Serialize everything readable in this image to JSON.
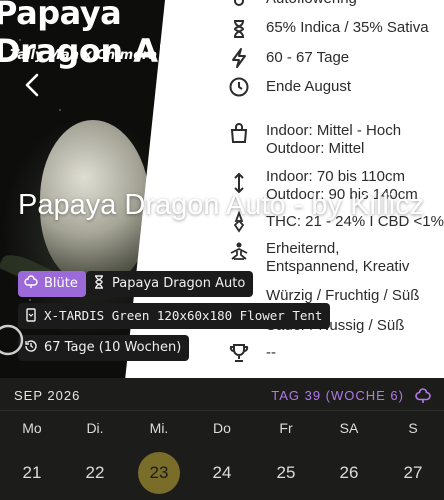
{
  "hero": {
    "strain_logo_line1": "Papaya",
    "strain_logo_line2": "Dragon Auto",
    "strain_cross": "Tally Man x Chimera",
    "overlay_title": "Papaya Dragon Auto - by Killicz"
  },
  "specs": [
    {
      "icon": "flower-icon",
      "text": "Autoflowering"
    },
    {
      "icon": "hourglass-icon",
      "text": "65% Indica / 35% Sativa"
    },
    {
      "icon": "lightning-icon",
      "text": "60 - 67 Tage"
    },
    {
      "icon": "clock-icon",
      "text": "Ende August"
    },
    {
      "icon": "bag-icon",
      "text": "Indoor: Mittel - Hoch",
      "text2": "Outdoor: Mittel"
    },
    {
      "icon": "height-arrow-icon",
      "text": "Indoor: 70 bis 110cm",
      "text2": "Outdoor: 90 bis 140cm"
    },
    {
      "icon": "thc-icon",
      "text": "THC: 21 - 24% I CBD <1%"
    },
    {
      "icon": "meditation-icon",
      "text": "Erheiternd,",
      "text2": "Entspannend, Kreativ"
    },
    {
      "icon": "taste-icon",
      "text": "Würzig / Fruchtig / Süß"
    },
    {
      "icon": "smell-icon",
      "text": "Sauer / Nussig / Süß"
    },
    {
      "icon": "trophy-icon",
      "text": "--"
    }
  ],
  "chips": {
    "phase": "Blüte",
    "strain": "Papaya Dragon Auto",
    "tent": "X-TARDIS Green 120x60x180 Flower Tent",
    "duration": "67 Tage (10 Wochen)"
  },
  "calendar": {
    "month": "SEP 2026",
    "week": "TAG 39 (WOCHE 6)",
    "accent_color": "#b17ae6",
    "today_color": "#7a6d2a",
    "days": [
      {
        "dow": "Mo",
        "date": "21"
      },
      {
        "dow": "Di.",
        "date": "22"
      },
      {
        "dow": "Mi.",
        "date": "23"
      },
      {
        "dow": "Do",
        "date": "24"
      },
      {
        "dow": "Fr",
        "date": "25"
      },
      {
        "dow": "SA",
        "date": "26"
      },
      {
        "dow": "S",
        "date": "27"
      }
    ]
  }
}
